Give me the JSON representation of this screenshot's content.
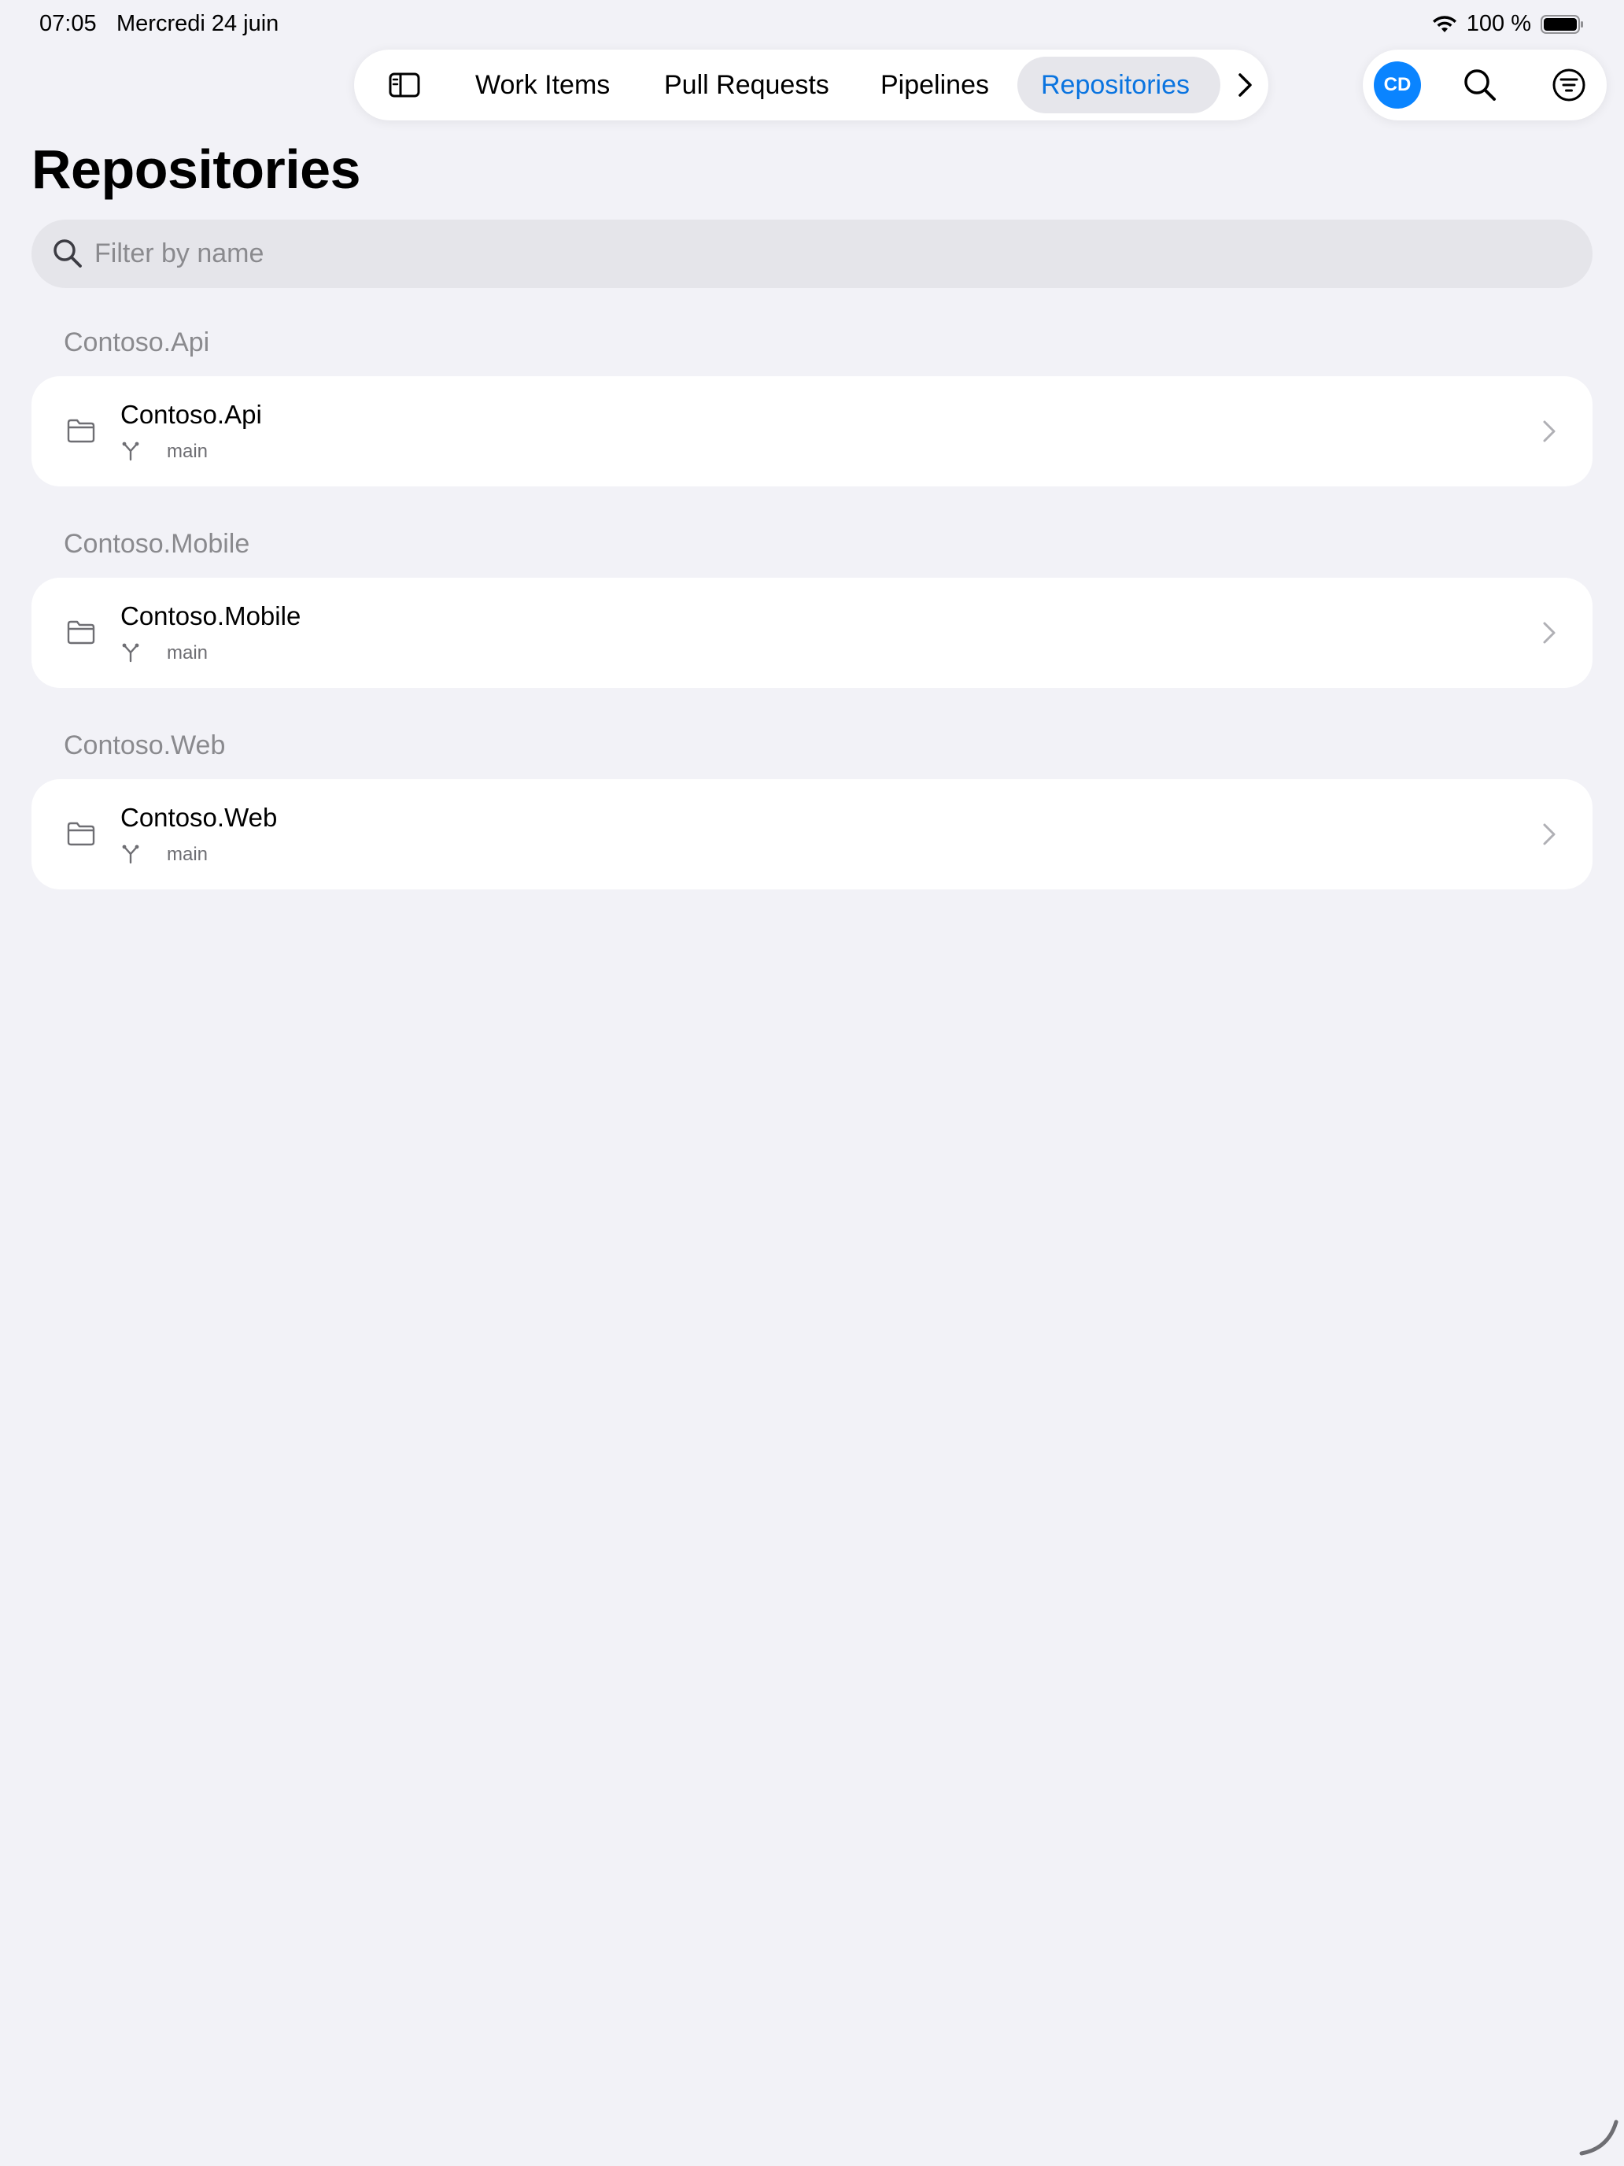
{
  "status": {
    "time": "07:05",
    "date": "Mercredi 24 juin",
    "battery": "100 %"
  },
  "tabs": {
    "items": [
      {
        "label": "Work Items"
      },
      {
        "label": "Pull Requests"
      },
      {
        "label": "Pipelines"
      },
      {
        "label": "Repositories"
      }
    ],
    "active": "Repositories"
  },
  "user": {
    "initials": "CD"
  },
  "page": {
    "title": "Repositories"
  },
  "search": {
    "placeholder": "Filter by name",
    "value": ""
  },
  "sections": [
    {
      "header": "Contoso.Api",
      "repo": {
        "name": "Contoso.Api",
        "branch": "main"
      }
    },
    {
      "header": "Contoso.Mobile",
      "repo": {
        "name": "Contoso.Mobile",
        "branch": "main"
      }
    },
    {
      "header": "Contoso.Web",
      "repo": {
        "name": "Contoso.Web",
        "branch": "main"
      }
    }
  ],
  "colors": {
    "accent": "#0a74e0",
    "avatar": "#0a84ff",
    "background": "#f2f2f7",
    "secondary_text": "#8a8a8e"
  }
}
